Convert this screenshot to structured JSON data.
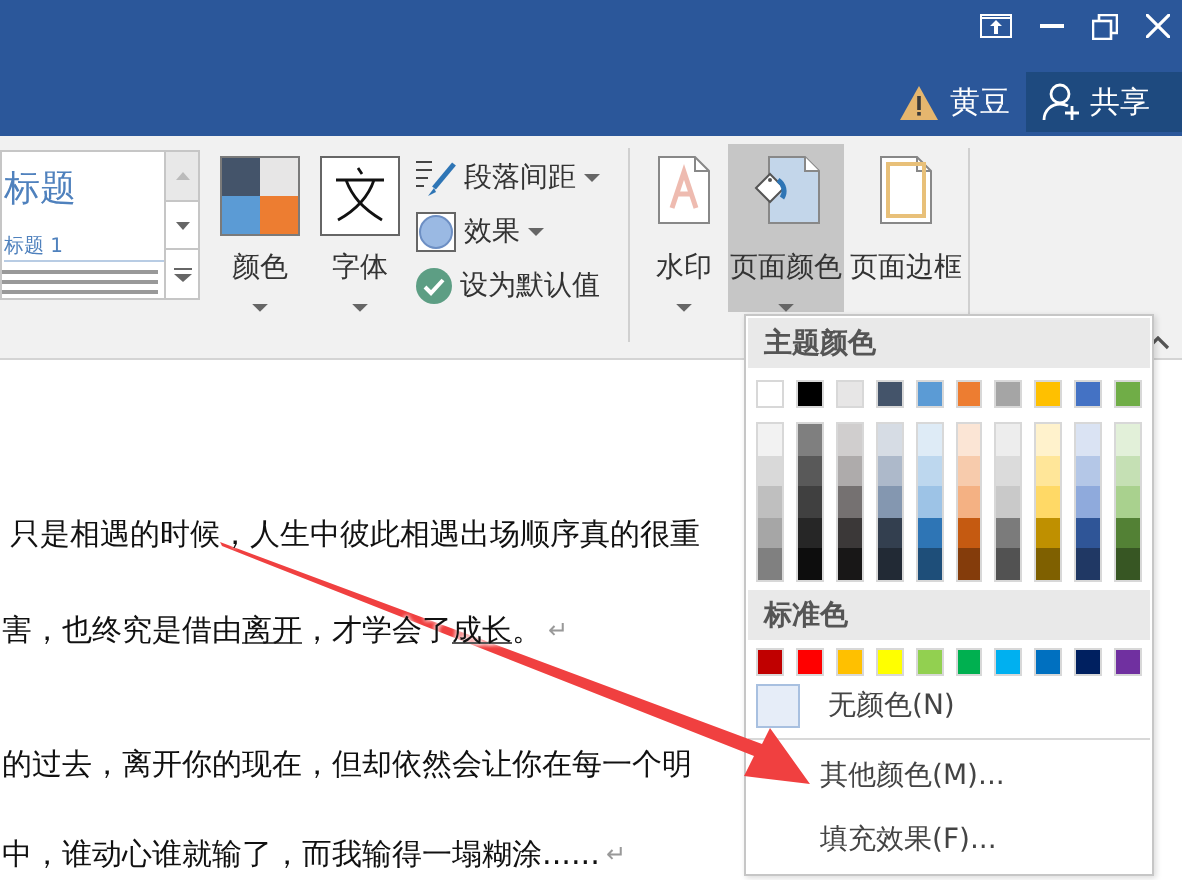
{
  "title_bar": {
    "account_name": "黄豆",
    "share_label": "共享"
  },
  "ribbon": {
    "style_gallery": {
      "heading": "标题",
      "subheading": "标题 1"
    },
    "big_buttons": [
      {
        "label": "颜色",
        "kind": "theme-colors",
        "dropdown": true
      },
      {
        "label": "字体",
        "kind": "fonts",
        "dropdown": true
      }
    ],
    "small_buttons": [
      {
        "label": "段落间距",
        "kind": "spacing",
        "dropdown": true
      },
      {
        "label": "效果",
        "kind": "effects",
        "dropdown": true
      },
      {
        "label": "设为默认值",
        "kind": "default",
        "dropdown": false
      }
    ],
    "page_buttons": [
      {
        "label": "水印",
        "kind": "watermark",
        "dropdown": true,
        "selected": false
      },
      {
        "label": "页面颜色",
        "kind": "page-color",
        "dropdown": true,
        "selected": true
      },
      {
        "label": "页面边框",
        "kind": "page-borders",
        "dropdown": false,
        "selected": false
      }
    ]
  },
  "document": {
    "paragraphs": [
      {
        "segments": [
          {
            "text": "只是相遇的时候，人生中彼此相遇出场顺序真的很重",
            "underlined": false
          }
        ]
      },
      {
        "segments": [
          {
            "text": "害，也终究是借由",
            "underlined": false
          },
          {
            "text": "离开",
            "underlined": true
          },
          {
            "text": "，才学会了",
            "underlined": false
          },
          {
            "text": "成长",
            "underlined": true
          },
          {
            "text": "。",
            "underlined": false
          }
        ],
        "mark": "↵"
      },
      {
        "segments": [
          {
            "text": "的过去，离开你的现在，但却依然会让你在每一个明",
            "underlined": false
          }
        ]
      },
      {
        "segments": [
          {
            "text": "中，谁动心谁就输了，而我输得一塌糊涂......",
            "underlined": false
          }
        ],
        "mark": "↵"
      }
    ]
  },
  "color_menu": {
    "theme_heading": "主题颜色",
    "theme_colors": [
      {
        "color": "#ffffff",
        "shades": [
          {
            "color": "#f2f2f2"
          },
          {
            "color": "#d9d9d9"
          },
          {
            "color": "#bfbfbf"
          },
          {
            "color": "#a6a6a6"
          },
          {
            "color": "#808080"
          }
        ]
      },
      {
        "color": "#000000",
        "shades": [
          {
            "color": "#7f7f7f"
          },
          {
            "color": "#595959"
          },
          {
            "color": "#404040"
          },
          {
            "color": "#262626"
          },
          {
            "color": "#0d0d0d"
          }
        ]
      },
      {
        "color": "#e7e6e6",
        "shades": [
          {
            "color": "#d0cece"
          },
          {
            "color": "#aeabab"
          },
          {
            "color": "#757171"
          },
          {
            "color": "#3b3838"
          },
          {
            "color": "#181717"
          }
        ]
      },
      {
        "color": "#44546a",
        "shades": [
          {
            "color": "#d6dce4"
          },
          {
            "color": "#adb9ca"
          },
          {
            "color": "#8497b0"
          },
          {
            "color": "#333f4f"
          },
          {
            "color": "#222a35"
          }
        ]
      },
      {
        "color": "#5b9bd5",
        "shades": [
          {
            "color": "#deebf6"
          },
          {
            "color": "#bdd7ee"
          },
          {
            "color": "#9dc3e6"
          },
          {
            "color": "#2e75b5"
          },
          {
            "color": "#1e4e79"
          }
        ]
      },
      {
        "color": "#ed7d31",
        "shades": [
          {
            "color": "#fbe5d5"
          },
          {
            "color": "#f7cbac"
          },
          {
            "color": "#f4b183"
          },
          {
            "color": "#c55a11"
          },
          {
            "color": "#843c0b"
          }
        ]
      },
      {
        "color": "#a5a5a5",
        "shades": [
          {
            "color": "#ededed"
          },
          {
            "color": "#dbdbdb"
          },
          {
            "color": "#c9c9c9"
          },
          {
            "color": "#7b7b7b"
          },
          {
            "color": "#525252"
          }
        ]
      },
      {
        "color": "#ffc000",
        "shades": [
          {
            "color": "#fff2cc"
          },
          {
            "color": "#ffe699"
          },
          {
            "color": "#ffd966"
          },
          {
            "color": "#bf9000"
          },
          {
            "color": "#7f6000"
          }
        ]
      },
      {
        "color": "#4472c4",
        "shades": [
          {
            "color": "#dae3f3"
          },
          {
            "color": "#b4c7e7"
          },
          {
            "color": "#8faadc"
          },
          {
            "color": "#2f5597"
          },
          {
            "color": "#203864"
          }
        ]
      },
      {
        "color": "#70ad47",
        "shades": [
          {
            "color": "#e2f0d9"
          },
          {
            "color": "#c5e0b4"
          },
          {
            "color": "#a9d18e"
          },
          {
            "color": "#538135"
          },
          {
            "color": "#375623"
          }
        ]
      }
    ],
    "standard_heading": "标准色",
    "standard_colors": [
      {
        "color": "#c00000"
      },
      {
        "color": "#ff0000"
      },
      {
        "color": "#ffc000"
      },
      {
        "color": "#ffff00"
      },
      {
        "color": "#92d050"
      },
      {
        "color": "#00b050"
      },
      {
        "color": "#00b0f0"
      },
      {
        "color": "#0070c0"
      },
      {
        "color": "#002060"
      },
      {
        "color": "#7030a0"
      }
    ],
    "items": [
      {
        "label": "无颜色(N)",
        "kind": "no-color"
      },
      {
        "label": "其他颜色(M)...",
        "kind": "more-colors"
      },
      {
        "label": "填充效果(F)...",
        "kind": "fill-effects"
      }
    ]
  }
}
